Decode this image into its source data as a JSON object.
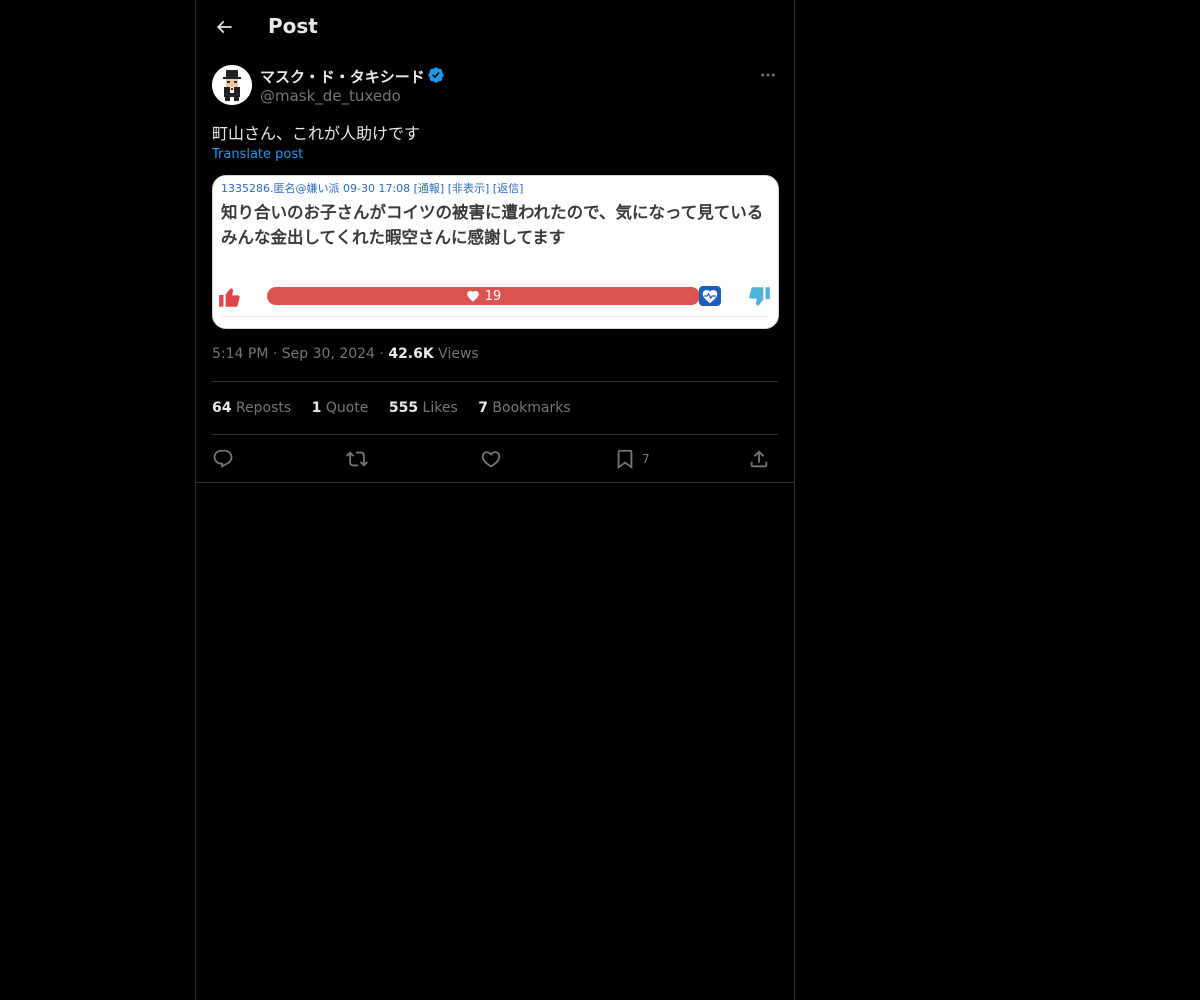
{
  "header": {
    "title": "Post"
  },
  "author": {
    "display_name": "マスク・ド・タキシード",
    "handle": "@mask_de_tuxedo",
    "verified_color": "#1d9bf0"
  },
  "post": {
    "text": "町山さん、これが人助けです",
    "translate_label": "Translate post"
  },
  "card": {
    "meta": "1335286.匿名@嫌い派 09-30 17:08 [通報] [非表示] [返信]",
    "body_line1": "知り合いのお子さんがコイツの被害に遭われたので、気になって見ている",
    "body_line2": "みんな金出してくれた暇空さんに感謝してます",
    "vote_count": "19"
  },
  "meta": {
    "time": "5:14 PM",
    "date": "Sep 30, 2024",
    "views_count": "42.6K",
    "views_label": "Views"
  },
  "stats": {
    "reposts_count": "64",
    "reposts_label": "Reposts",
    "quotes_count": "1",
    "quotes_label": "Quote",
    "likes_count": "555",
    "likes_label": "Likes",
    "bookmarks_count": "7",
    "bookmarks_label": "Bookmarks"
  },
  "actions": {
    "reply_icon": "reply-icon",
    "repost_icon": "repost-icon",
    "like_icon": "heart-icon",
    "bookmark_icon": "bookmark-icon",
    "bookmark_count": "7",
    "share_icon": "share-icon"
  }
}
